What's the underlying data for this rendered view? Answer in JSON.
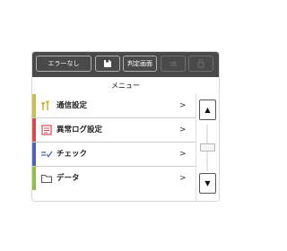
{
  "toolbar": {
    "error_label": "エラーなし",
    "judgment_screen_label": "判定画面"
  },
  "header": {
    "title": "メニュー"
  },
  "menu": {
    "items": [
      {
        "label": "通信設定",
        "icon": "antenna-signal-icon",
        "color": "#c9c04a"
      },
      {
        "label": "異常ログ設定",
        "icon": "log-document-icon",
        "color": "#d94a50"
      },
      {
        "label": "チェック",
        "icon": "check-lines-icon",
        "color": "#4f64b5"
      },
      {
        "label": "データ",
        "icon": "folder-icon",
        "color": "#8cc04a"
      }
    ],
    "chevron": ">"
  },
  "scrollbar": {
    "up": "▲",
    "down": "▼"
  },
  "colors": {
    "toolbar_bg": "#4a4a4a",
    "accent_yellow": "#c9c04a",
    "accent_red": "#d94a50",
    "accent_blue": "#4f64b5",
    "accent_green": "#8cc04a"
  }
}
